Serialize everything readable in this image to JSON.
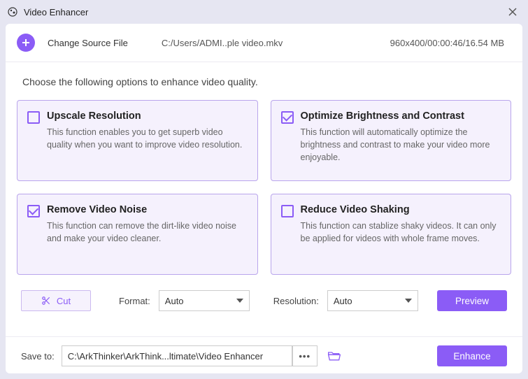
{
  "titlebar": {
    "title": "Video Enhancer"
  },
  "source": {
    "change_label": "Change Source File",
    "path": "C:/Users/ADMI..ple video.mkv",
    "meta": "960x400/00:00:46/16.54 MB"
  },
  "instruction": "Choose the following options to enhance video quality.",
  "cards": [
    {
      "title": "Upscale Resolution",
      "desc": "This function enables you to get superb video quality when you want to improve video resolution.",
      "checked": false
    },
    {
      "title": "Optimize Brightness and Contrast",
      "desc": "This function will automatically optimize the brightness and contrast to make your video more enjoyable.",
      "checked": true
    },
    {
      "title": "Remove Video Noise",
      "desc": "This function can remove the dirt-like video noise and make your video cleaner.",
      "checked": true
    },
    {
      "title": "Reduce Video Shaking",
      "desc": "This function can stablize shaky videos. It can only be applied for videos with whole frame moves.",
      "checked": false
    }
  ],
  "controls": {
    "cut_label": "Cut",
    "format_label": "Format:",
    "format_value": "Auto",
    "resolution_label": "Resolution:",
    "resolution_value": "Auto",
    "preview_label": "Preview"
  },
  "save": {
    "label": "Save to:",
    "path": "C:\\ArkThinker\\ArkThink...ltimate\\Video Enhancer",
    "enhance_label": "Enhance"
  }
}
